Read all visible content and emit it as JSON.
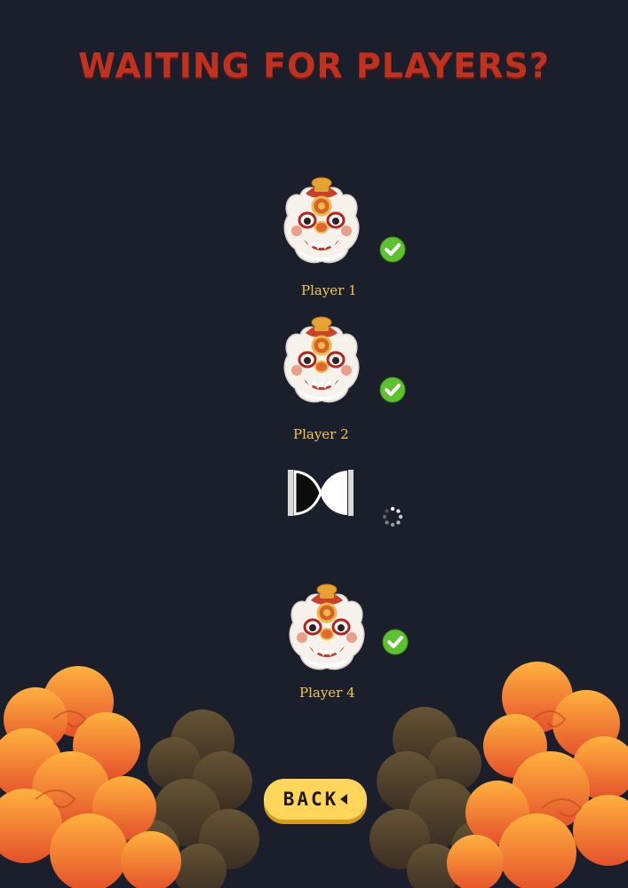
{
  "header": {
    "title": "WAITING FOR PLAYERS?"
  },
  "players": [
    {
      "name": "Player 1",
      "status": "ready",
      "avatar": "lion-dance-head-icon"
    },
    {
      "name": "Player 2",
      "status": "ready",
      "avatar": "lion-dance-head-icon"
    },
    {
      "name": "",
      "status": "waiting",
      "avatar": "empty-seat-icon"
    },
    {
      "name": "Player 4",
      "status": "ready",
      "avatar": "lion-dance-head-icon"
    }
  ],
  "back_button": {
    "label": "BACK",
    "icon": "triangle-left-icon"
  },
  "colors": {
    "background": "#1b1f2b",
    "title": "#c0321f",
    "player_name": "#f4c452",
    "ready_check": "#5cc22d",
    "button": "#ffd65a"
  }
}
